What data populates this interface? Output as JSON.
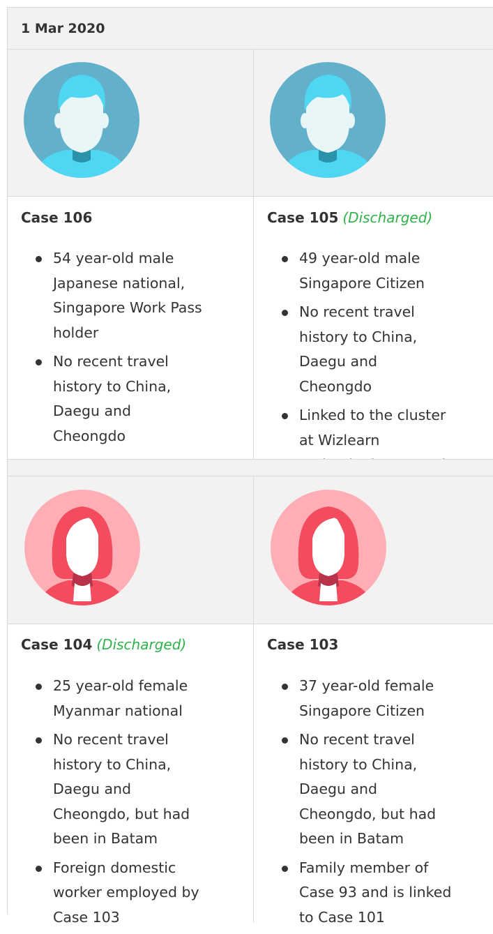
{
  "date_label": "1 Mar 2020",
  "cases": [
    {
      "title": "Case 106",
      "status": "",
      "gender": "male",
      "details": [
        "54 year-old male Japanese national, Singapore Work Pass holder",
        "No recent travel history to China, Daegu and Cheongdo"
      ]
    },
    {
      "title": "Case 105",
      "status": "(Discharged)",
      "gender": "male",
      "details": [
        "49 year-old male Singapore Citizen",
        "No recent travel history to China, Daegu and Cheongdo",
        "Linked to the cluster at Wizlearn Technologies Pte Ltd"
      ]
    },
    {
      "title": "Case 104",
      "status": "(Discharged)",
      "gender": "female",
      "details": [
        "25 year-old female Myanmar national",
        "No recent travel history to China, Daegu and Cheongdo, but had been in Batam",
        "Foreign domestic worker employed by Case 103"
      ]
    },
    {
      "title": "Case 103",
      "status": "",
      "gender": "female",
      "details": [
        "37 year-old female Singapore Citizen",
        "No recent travel history to China, Daegu and Cheongdo, but had been in Batam",
        "Family member of Case 93 and is linked to Case 101"
      ]
    }
  ],
  "colors": {
    "male_bg": "#62b0c9",
    "male_accent": "#4fd6f2",
    "female_bg": "#ffaeb5",
    "female_accent": "#f24c5e",
    "discharged": "#2fb24a"
  },
  "icons": {
    "male": "male-avatar-icon",
    "female": "female-avatar-icon",
    "bullet": "bullet-icon"
  }
}
